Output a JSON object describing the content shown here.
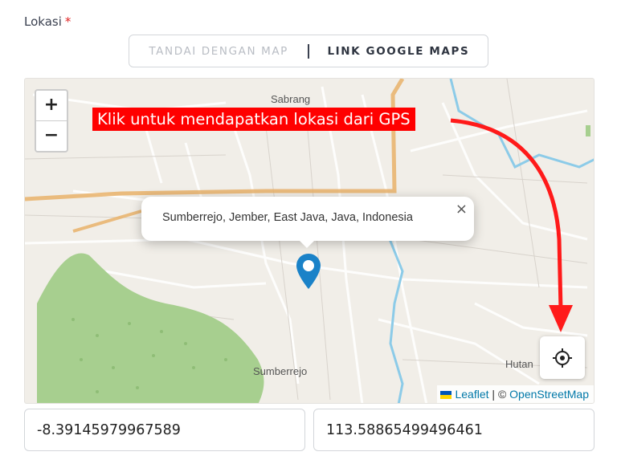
{
  "form": {
    "label": "Lokasi",
    "required_mark": "*"
  },
  "mode_toggle": {
    "option_map": "TANDAI DENGAN MAP",
    "option_link": "LINK GOOGLE MAPS",
    "active": "LINK GOOGLE MAPS"
  },
  "map": {
    "zoom_in": "+",
    "zoom_out": "−",
    "hint": "Klik untuk mendapatkan lokasi dari GPS",
    "popup_text": "Sumberrejo, Jember, East Java, Java, Indonesia",
    "popup_close": "×",
    "labels": {
      "sabrang": "Sabrang",
      "sumberrejo": "Sumberrejo",
      "hutan": "Hutan"
    },
    "attribution": {
      "leaflet": "Leaflet",
      "separator": "| ©",
      "osm": "OpenStreetMap"
    },
    "icons": {
      "marker": "map-marker-icon",
      "locate": "crosshair-icon",
      "flag": "ukraine-flag-icon"
    },
    "colors": {
      "marker": "#1a82c8",
      "hint_bg": "#ff0000",
      "forest": "#a7cf8f",
      "river": "#8ccbe8",
      "road": "#f3be80"
    }
  },
  "coordinates": {
    "latitude": "-8.39145979967589",
    "longitude": "113.58865499496461"
  }
}
